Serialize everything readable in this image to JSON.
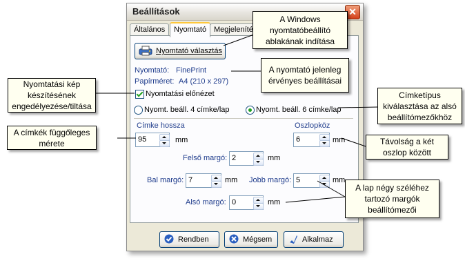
{
  "window": {
    "title": "Beállítások"
  },
  "tabs": [
    {
      "label": "Általános"
    },
    {
      "label": "Nyomtató"
    },
    {
      "label": "Megjelenítés"
    }
  ],
  "printer": {
    "button_label": "Nyomtató választás",
    "printer_label": "Nyomtató:",
    "printer_value": "FinePrint",
    "paper_label": "Papírméret:",
    "paper_value": "A4 (210 x 297)"
  },
  "preview": {
    "label": "Nyomtatási előnézet",
    "checked": true
  },
  "layout_options": [
    {
      "label": "Nyomt. beáll. 4 címke/lap",
      "selected": false
    },
    {
      "label": "Nyomt. beáll. 6 címke/lap",
      "selected": true
    }
  ],
  "fields": {
    "label_height": {
      "label": "Címke hossza",
      "value": "95",
      "unit": "mm"
    },
    "column_gap": {
      "label": "Oszlopköz",
      "value": "6",
      "unit": "mm"
    },
    "top_margin": {
      "label": "Felső margó:",
      "value": "2",
      "unit": "mm"
    },
    "left_margin": {
      "label": "Bal margó:",
      "value": "7",
      "unit": "mm"
    },
    "right_margin": {
      "label": "Jobb margó:",
      "value": "5",
      "unit": "mm"
    },
    "bottom_margin": {
      "label": "Alsó margó:",
      "value": "0",
      "unit": "mm"
    }
  },
  "buttons": {
    "ok": {
      "label": "Rendben"
    },
    "cancel": {
      "label": "Mégsem"
    },
    "apply": {
      "label": "Alkalmaz"
    }
  },
  "callouts": {
    "windows_printer": "A Windows nyomtatóbeállító ablakának indítása",
    "current_printer": "A nyomtató jelenleg érvényes beállításai",
    "preview_toggle": "Nyomtatási kép készítésének engedélyezése/tiltása",
    "label_type": "Címketípus kiválasztása az alsó beállítómezőkhöz",
    "label_height": "A címkék függőleges mérete",
    "column_gap": "Távolság a két oszlop között",
    "margins": "A lap négy széléhez tartozó margók beállítómezői"
  },
  "colors": {
    "label_blue": "#1f3c8c",
    "window_bg": "#ece9d8",
    "close_red": "#d5401a",
    "tab_highlight": "#ffc83c",
    "check_green": "#21a121",
    "callout_bg": "#fffff0"
  }
}
